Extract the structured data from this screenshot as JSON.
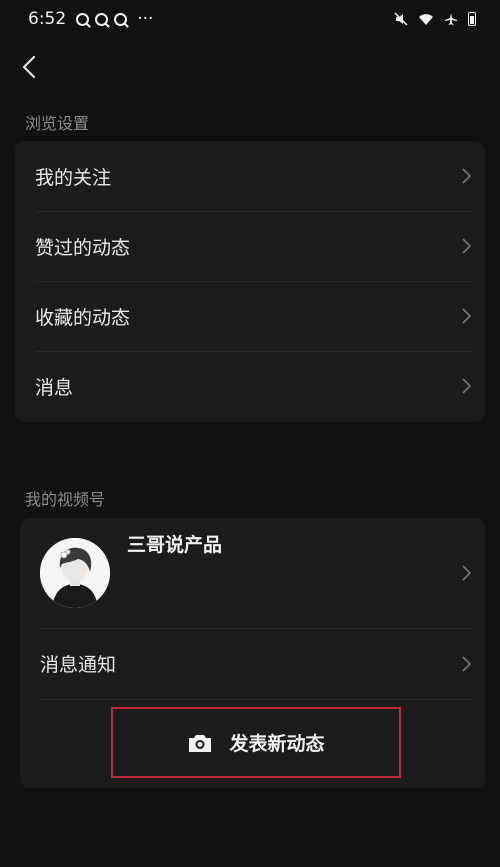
{
  "status_bar": {
    "time": "6:52",
    "extra": "···"
  },
  "browse_settings": {
    "section_title": "浏览设置",
    "items": [
      {
        "label": "我的关注"
      },
      {
        "label": "赞过的动态"
      },
      {
        "label": "收藏的动态"
      },
      {
        "label": "消息"
      }
    ]
  },
  "my_channel": {
    "section_title": "我的视频号",
    "channel_name": "三哥说产品",
    "notification_label": "消息通知",
    "post_button_label": "发表新动态"
  },
  "colors": {
    "background": "#111111",
    "card": "#1c1c1c",
    "highlight_border": "#c8283a"
  }
}
